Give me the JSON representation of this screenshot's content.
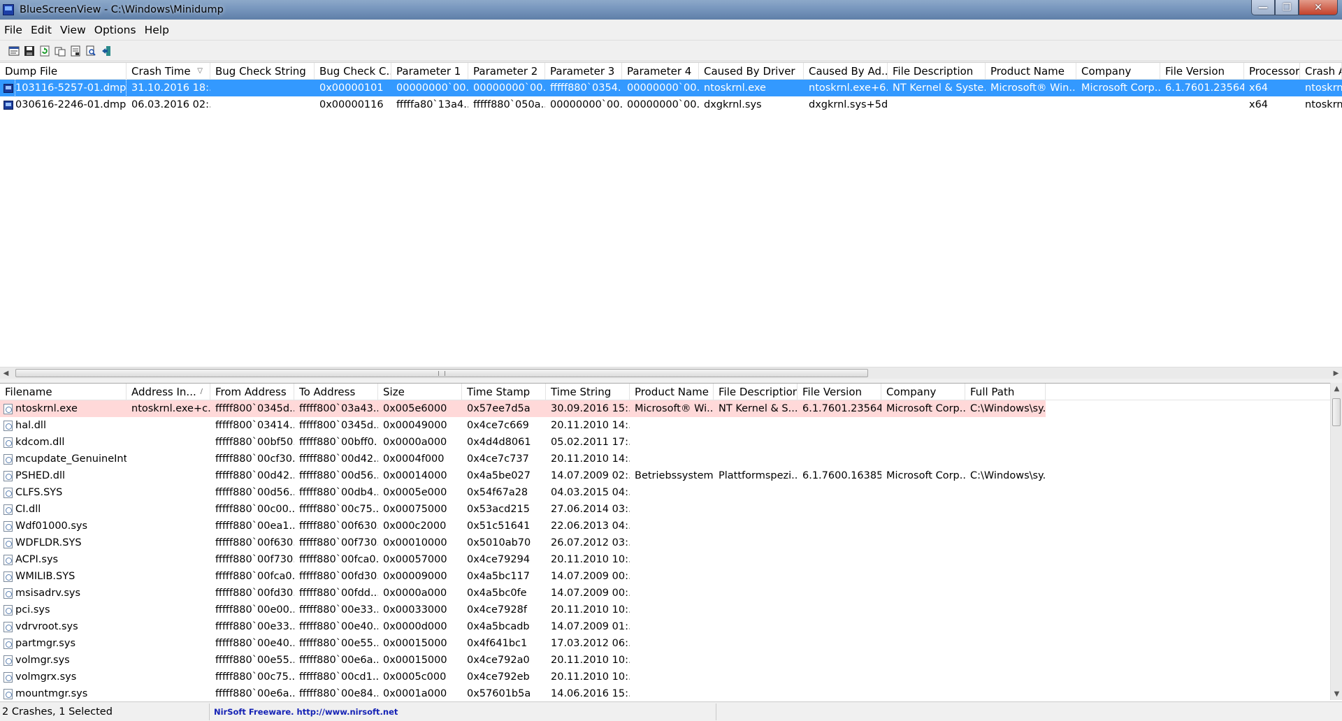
{
  "window": {
    "title": "BlueScreenView  -  C:\\Windows\\Minidump",
    "minimize_glyph": "—",
    "maximize_glyph": "❐",
    "close_glyph": "✕"
  },
  "menu": [
    "File",
    "Edit",
    "View",
    "Options",
    "Help"
  ],
  "toolbar": [
    "html-report-icon",
    "save-icon",
    "refresh-icon",
    "copy-icon",
    "properties-icon",
    "find-icon",
    "exit-icon"
  ],
  "crash_list": {
    "columns": [
      "Dump File",
      "Crash Time",
      "Bug Check String",
      "Bug Check C...",
      "Parameter 1",
      "Parameter 2",
      "Parameter 3",
      "Parameter 4",
      "Caused By Driver",
      "Caused By Ad...",
      "File Description",
      "Product Name",
      "Company",
      "File Version",
      "Processor",
      "Crash Ad"
    ],
    "sort_indicator": "▽",
    "rows": [
      [
        "103116-5257-01.dmp",
        "31.10.2016 18:...",
        "",
        "0x00000101",
        "00000000`00...",
        "00000000`00...",
        "fffff880`0354...",
        "00000000`00...",
        "ntoskrnl.exe",
        "ntoskrnl.exe+6...",
        "NT Kernel & Syste...",
        "Microsoft® Win...",
        "Microsoft Corp...",
        "6.1.7601.23564...",
        "x64",
        "ntoskrnl"
      ],
      [
        "030616-2246-01.dmp",
        "06.03.2016 02:...",
        "",
        "0x00000116",
        "fffffa80`13a4...",
        "fffff880`050a...",
        "00000000`00...",
        "00000000`00...",
        "dxgkrnl.sys",
        "dxgkrnl.sys+5d...",
        "",
        "",
        "",
        "",
        "x64",
        "ntoskrnl"
      ]
    ]
  },
  "driver_list": {
    "columns": [
      "Filename",
      "Address In...",
      "From Address",
      "To Address",
      "Size",
      "Time Stamp",
      "Time String",
      "Product Name",
      "File Description",
      "File Version",
      "Company",
      "Full Path"
    ],
    "sort_indicator": "/",
    "rows": [
      [
        "ntoskrnl.exe",
        "ntoskrnl.exe+c...",
        "fffff800`0345d...",
        "fffff800`03a43...",
        "0x005e6000",
        "0x57ee7d5a",
        "30.09.2016 15:...",
        "Microsoft® Wi...",
        "NT Kernel & S...",
        "6.1.7601.23564...",
        "Microsoft Corp...",
        "C:\\Windows\\sy..."
      ],
      [
        "hal.dll",
        "",
        "fffff800`03414...",
        "fffff800`0345d...",
        "0x00049000",
        "0x4ce7c669",
        "20.11.2010 14:...",
        "",
        "",
        "",
        "",
        ""
      ],
      [
        "kdcom.dll",
        "",
        "fffff880`00bf50...",
        "fffff880`00bff0...",
        "0x0000a000",
        "0x4d4d8061",
        "05.02.2011 17:...",
        "",
        "",
        "",
        "",
        ""
      ],
      [
        "mcupdate_GenuineInt...",
        "",
        "fffff880`00cf30...",
        "fffff880`00d42...",
        "0x0004f000",
        "0x4ce7c737",
        "20.11.2010 14:...",
        "",
        "",
        "",
        "",
        ""
      ],
      [
        "PSHED.dll",
        "",
        "fffff880`00d42...",
        "fffff880`00d56...",
        "0x00014000",
        "0x4a5be027",
        "14.07.2009 02:...",
        "Betriebssystem...",
        "Plattformspezi...",
        "6.1.7600.16385...",
        "Microsoft Corp...",
        "C:\\Windows\\sy..."
      ],
      [
        "CLFS.SYS",
        "",
        "fffff880`00d56...",
        "fffff880`00db4...",
        "0x0005e000",
        "0x54f67a28",
        "04.03.2015 04:...",
        "",
        "",
        "",
        "",
        ""
      ],
      [
        "CI.dll",
        "",
        "fffff880`00c00...",
        "fffff880`00c75...",
        "0x00075000",
        "0x53acd215",
        "27.06.2014 03:...",
        "",
        "",
        "",
        "",
        ""
      ],
      [
        "Wdf01000.sys",
        "",
        "fffff880`00ea1...",
        "fffff880`00f630...",
        "0x000c2000",
        "0x51c51641",
        "22.06.2013 04:...",
        "",
        "",
        "",
        "",
        ""
      ],
      [
        "WDFLDR.SYS",
        "",
        "fffff880`00f630...",
        "fffff880`00f730...",
        "0x00010000",
        "0x5010ab70",
        "26.07.2012 03:...",
        "",
        "",
        "",
        "",
        ""
      ],
      [
        "ACPI.sys",
        "",
        "fffff880`00f730...",
        "fffff880`00fca0...",
        "0x00057000",
        "0x4ce79294",
        "20.11.2010 10:...",
        "",
        "",
        "",
        "",
        ""
      ],
      [
        "WMILIB.SYS",
        "",
        "fffff880`00fca0...",
        "fffff880`00fd30...",
        "0x00009000",
        "0x4a5bc117",
        "14.07.2009 00:...",
        "",
        "",
        "",
        "",
        ""
      ],
      [
        "msisadrv.sys",
        "",
        "fffff880`00fd30...",
        "fffff880`00fdd...",
        "0x0000a000",
        "0x4a5bc0fe",
        "14.07.2009 00:...",
        "",
        "",
        "",
        "",
        ""
      ],
      [
        "pci.sys",
        "",
        "fffff880`00e00...",
        "fffff880`00e33...",
        "0x00033000",
        "0x4ce7928f",
        "20.11.2010 10:...",
        "",
        "",
        "",
        "",
        ""
      ],
      [
        "vdrvroot.sys",
        "",
        "fffff880`00e33...",
        "fffff880`00e40...",
        "0x0000d000",
        "0x4a5bcadb",
        "14.07.2009 01:...",
        "",
        "",
        "",
        "",
        ""
      ],
      [
        "partmgr.sys",
        "",
        "fffff880`00e40...",
        "fffff880`00e55...",
        "0x00015000",
        "0x4f641bc1",
        "17.03.2012 06:...",
        "",
        "",
        "",
        "",
        ""
      ],
      [
        "volmgr.sys",
        "",
        "fffff880`00e55...",
        "fffff880`00e6a...",
        "0x00015000",
        "0x4ce792a0",
        "20.11.2010 10:...",
        "",
        "",
        "",
        "",
        ""
      ],
      [
        "volmgrx.sys",
        "",
        "fffff880`00c75...",
        "fffff880`00cd1...",
        "0x0005c000",
        "0x4ce792eb",
        "20.11.2010 10:...",
        "",
        "",
        "",
        "",
        ""
      ],
      [
        "mountmgr.sys",
        "",
        "fffff880`00e6a...",
        "fffff880`00e84...",
        "0x0001a000",
        "0x57601b5a",
        "14.06.2016 15:...",
        "",
        "",
        "",
        "",
        ""
      ]
    ]
  },
  "status": {
    "count": "2 Crashes, 1 Selected",
    "vendor": "NirSoft Freeware.  http://www.nirsoft.net"
  },
  "colors": {
    "selection": "#3399ff",
    "highlight_row": "#ffd9d9",
    "status_link": "#1522b5"
  }
}
